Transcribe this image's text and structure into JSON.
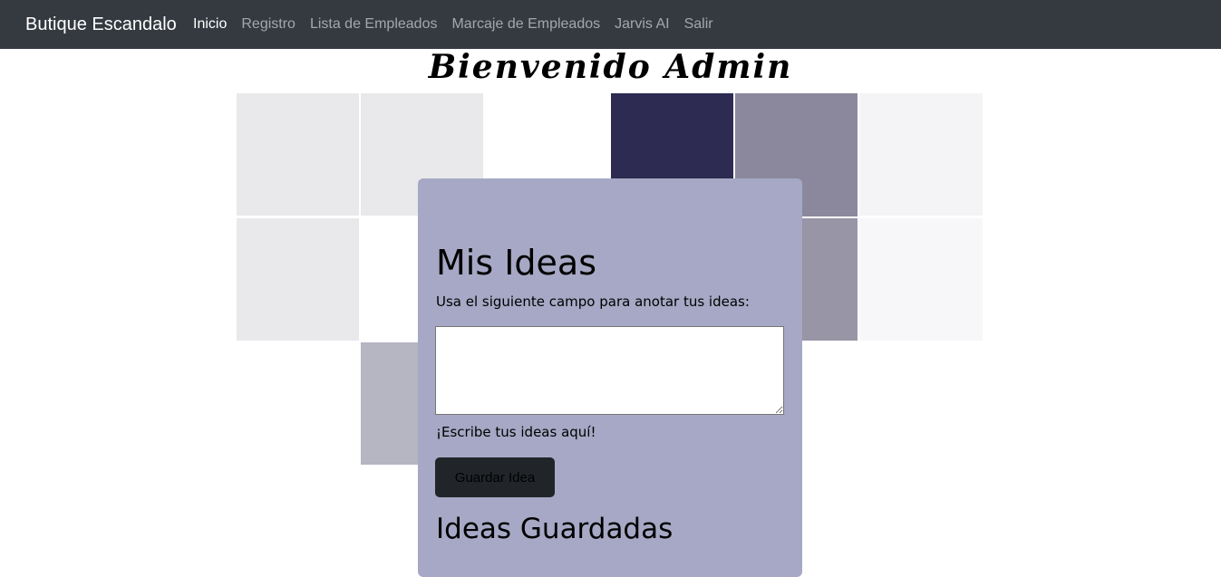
{
  "navbar": {
    "brand": "Butique Escandalo",
    "links": [
      {
        "label": "Inicio",
        "active": true
      },
      {
        "label": "Registro",
        "active": false
      },
      {
        "label": "Lista de Empleados",
        "active": false
      },
      {
        "label": "Marcaje de Empleados",
        "active": false
      },
      {
        "label": "Jarvis AI",
        "active": false
      },
      {
        "label": "Salir",
        "active": false
      }
    ]
  },
  "welcome": "Bienvenido Admin",
  "ideas_card": {
    "title": "Mis Ideas",
    "instructions": "Usa el siguiente campo para anotar tus ideas:",
    "textarea_value": "",
    "hint": "¡Escribe tus ideas aquí!",
    "save_button": "Guardar Idea",
    "saved_title": "Ideas Guardadas"
  },
  "colors": {
    "navbar_bg": "#343a40",
    "card_bg": "#a6a8c5",
    "button_bg": "#212529",
    "tile_dark": "#2d2b52",
    "tile_mid": "#8b889d"
  }
}
